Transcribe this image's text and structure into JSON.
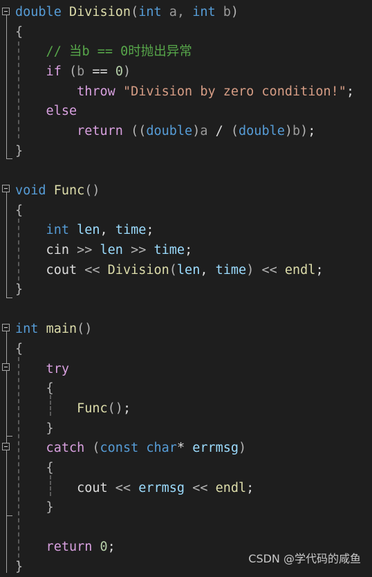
{
  "editor": {
    "theme": {
      "background": "#1e1e1e",
      "keyword": "#569cd6",
      "control": "#d8a0df",
      "function": "#dcdcaa",
      "string": "#d69d85",
      "comment": "#57a64a",
      "variable": "#9cdcfe",
      "number": "#b5cea8",
      "plain": "#dcdcdc"
    },
    "lines": [
      {
        "tokens": [
          [
            "kw",
            "double"
          ],
          [
            "plain",
            " "
          ],
          [
            "fn",
            "Division"
          ],
          [
            "op",
            "("
          ],
          [
            "kw",
            "int"
          ],
          [
            "param",
            " a, "
          ],
          [
            "kw",
            "int"
          ],
          [
            "param",
            " b"
          ],
          [
            "op",
            ")"
          ]
        ]
      },
      {
        "tokens": [
          [
            "op",
            "{"
          ]
        ]
      },
      {
        "tokens": [
          [
            "cm",
            "    // 当b == 0时抛出异常"
          ]
        ]
      },
      {
        "tokens": [
          [
            "ctl",
            "    if"
          ],
          [
            "plain",
            " "
          ],
          [
            "op",
            "("
          ],
          [
            "param",
            "b"
          ],
          [
            "plain",
            " == "
          ],
          [
            "num",
            "0"
          ],
          [
            "op",
            ")"
          ]
        ]
      },
      {
        "tokens": [
          [
            "ctl",
            "        throw"
          ],
          [
            "plain",
            " "
          ],
          [
            "str",
            "\"Division by zero condition!\""
          ],
          [
            "plain",
            ";"
          ]
        ]
      },
      {
        "tokens": [
          [
            "ctl",
            "    else"
          ]
        ]
      },
      {
        "tokens": [
          [
            "ctl",
            "        return"
          ],
          [
            "plain",
            " "
          ],
          [
            "op",
            "(("
          ],
          [
            "kw",
            "double"
          ],
          [
            "op",
            ")"
          ],
          [
            "param",
            "a"
          ],
          [
            "plain",
            " / "
          ],
          [
            "op",
            "("
          ],
          [
            "kw",
            "double"
          ],
          [
            "op",
            ")"
          ],
          [
            "param",
            "b"
          ],
          [
            "op",
            ")"
          ],
          [
            "plain",
            ";"
          ]
        ]
      },
      {
        "tokens": [
          [
            "op",
            "}"
          ]
        ]
      },
      {
        "tokens": []
      },
      {
        "tokens": [
          [
            "kw",
            "void"
          ],
          [
            "plain",
            " "
          ],
          [
            "fn",
            "Func"
          ],
          [
            "op",
            "()"
          ]
        ]
      },
      {
        "tokens": [
          [
            "op",
            "{"
          ]
        ]
      },
      {
        "tokens": [
          [
            "kw",
            "    int"
          ],
          [
            "plain",
            " "
          ],
          [
            "var",
            "len"
          ],
          [
            "plain",
            ", "
          ],
          [
            "var",
            "time"
          ],
          [
            "plain",
            ";"
          ]
        ]
      },
      {
        "tokens": [
          [
            "plain",
            "    cin "
          ],
          [
            "op",
            ">>"
          ],
          [
            "plain",
            " "
          ],
          [
            "var",
            "len"
          ],
          [
            "plain",
            " "
          ],
          [
            "op",
            ">>"
          ],
          [
            "plain",
            " "
          ],
          [
            "var",
            "time"
          ],
          [
            "plain",
            ";"
          ]
        ]
      },
      {
        "tokens": [
          [
            "plain",
            "    cout "
          ],
          [
            "op",
            "<<"
          ],
          [
            "plain",
            " "
          ],
          [
            "fn",
            "Division"
          ],
          [
            "op",
            "("
          ],
          [
            "var",
            "len"
          ],
          [
            "plain",
            ", "
          ],
          [
            "var",
            "time"
          ],
          [
            "op",
            ")"
          ],
          [
            "plain",
            " "
          ],
          [
            "op",
            "<<"
          ],
          [
            "plain",
            " "
          ],
          [
            "fn",
            "endl"
          ],
          [
            "plain",
            ";"
          ]
        ]
      },
      {
        "tokens": [
          [
            "op",
            "}"
          ]
        ]
      },
      {
        "tokens": []
      },
      {
        "tokens": [
          [
            "kw",
            "int"
          ],
          [
            "plain",
            " "
          ],
          [
            "fn",
            "main"
          ],
          [
            "op",
            "()"
          ]
        ]
      },
      {
        "tokens": [
          [
            "op",
            "{"
          ]
        ]
      },
      {
        "tokens": [
          [
            "ctl",
            "    try"
          ]
        ]
      },
      {
        "tokens": [
          [
            "op",
            "    {"
          ]
        ]
      },
      {
        "tokens": [
          [
            "fn",
            "        Func"
          ],
          [
            "op",
            "()"
          ],
          [
            "plain",
            ";"
          ]
        ]
      },
      {
        "tokens": [
          [
            "op",
            "    }"
          ]
        ]
      },
      {
        "tokens": [
          [
            "ctl",
            "    catch"
          ],
          [
            "plain",
            " "
          ],
          [
            "op",
            "("
          ],
          [
            "kw",
            "const"
          ],
          [
            "plain",
            " "
          ],
          [
            "kw",
            "char"
          ],
          [
            "plain",
            "* "
          ],
          [
            "var",
            "errmsg"
          ],
          [
            "op",
            ")"
          ]
        ]
      },
      {
        "tokens": [
          [
            "op",
            "    {"
          ]
        ]
      },
      {
        "tokens": [
          [
            "plain",
            "        cout "
          ],
          [
            "op",
            "<<"
          ],
          [
            "plain",
            " "
          ],
          [
            "var",
            "errmsg"
          ],
          [
            "plain",
            " "
          ],
          [
            "op",
            "<<"
          ],
          [
            "plain",
            " "
          ],
          [
            "fn",
            "endl"
          ],
          [
            "plain",
            ";"
          ]
        ]
      },
      {
        "tokens": [
          [
            "op",
            "    }"
          ]
        ]
      },
      {
        "tokens": []
      },
      {
        "tokens": [
          [
            "ctl",
            "    return"
          ],
          [
            "plain",
            " "
          ],
          [
            "num",
            "0"
          ],
          [
            "plain",
            ";"
          ]
        ]
      },
      {
        "tokens": [
          [
            "op",
            "}"
          ]
        ]
      }
    ]
  },
  "watermark": "CSDN @学代码的咸鱼"
}
